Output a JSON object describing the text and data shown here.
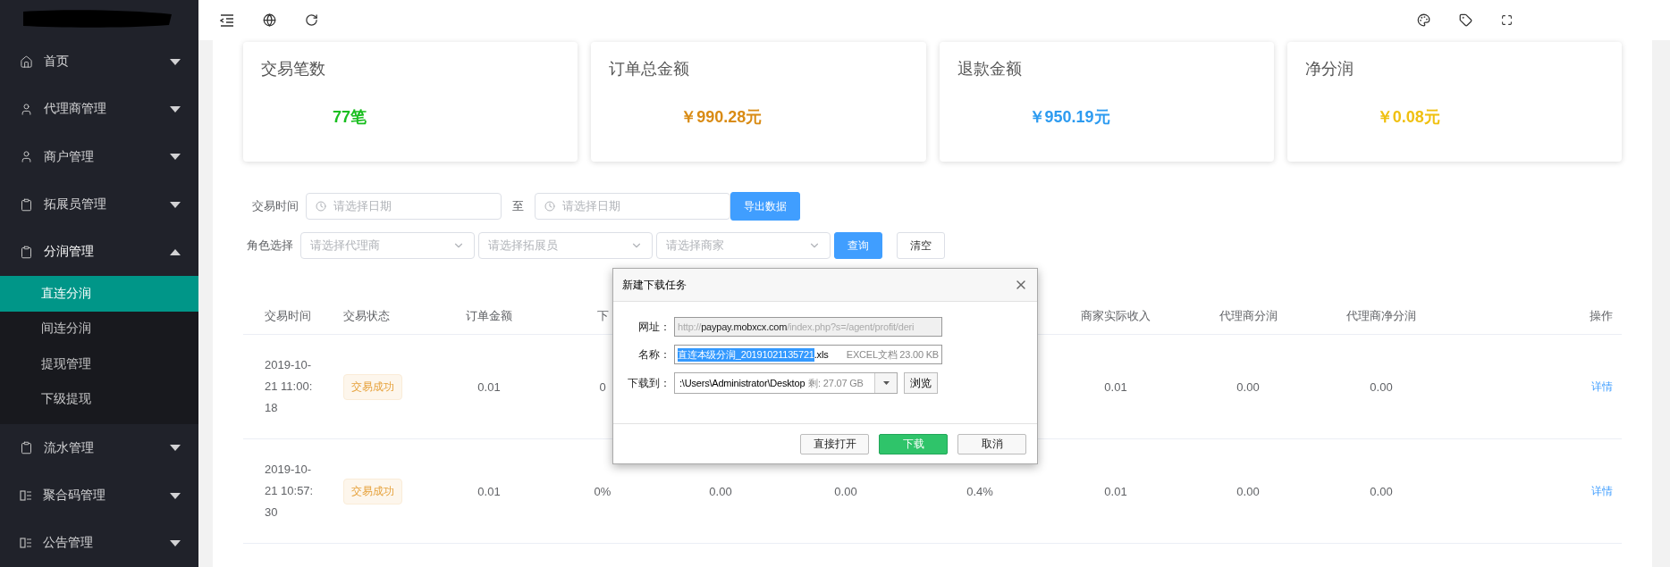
{
  "sidebar": {
    "items": [
      {
        "label": "首页",
        "expanded": false
      },
      {
        "label": "代理商管理",
        "expanded": false
      },
      {
        "label": "商户管理",
        "expanded": false
      },
      {
        "label": "拓展员管理",
        "expanded": false
      },
      {
        "label": "分润管理",
        "expanded": true,
        "children": [
          {
            "label": "直连分润",
            "selected": true
          },
          {
            "label": "间连分润",
            "selected": false
          },
          {
            "label": "提现管理",
            "selected": false
          },
          {
            "label": "下级提现",
            "selected": false
          }
        ]
      },
      {
        "label": "流水管理",
        "expanded": false
      },
      {
        "label": "聚合码管理",
        "expanded": false
      },
      {
        "label": "公告管理",
        "expanded": false
      }
    ]
  },
  "stats": [
    {
      "title": "交易笔数",
      "value": "77笔",
      "color": "#19be1f"
    },
    {
      "title": "订单总金额",
      "value": "￥990.28元",
      "color": "#d98b14"
    },
    {
      "title": "退款金额",
      "value": "￥950.19元",
      "color": "#2d9bf0"
    },
    {
      "title": "净分润",
      "value": "￥0.08元",
      "color": "#f0c010"
    }
  ],
  "filters": {
    "date_label": "交易时间",
    "date_from": {
      "placeholder": "请选择日期"
    },
    "date_sep": "至",
    "date_to": {
      "placeholder": "请选择日期"
    },
    "export_button": "导出数据",
    "role_label": "角色选择",
    "selects": [
      {
        "placeholder": "请选择代理商"
      },
      {
        "placeholder": "请选择拓展员"
      },
      {
        "placeholder": "请选择商家"
      }
    ],
    "query_button": "查询",
    "clear_button": "清空"
  },
  "table": {
    "columns": {
      "time": "交易时间",
      "status": "交易状态",
      "amount": "订单金额",
      "column_4": "下",
      "merchant_income": "商家实际收入",
      "agent_profit": "代理商分润",
      "agent_net_profit": "代理商净分润",
      "action": "操作"
    },
    "rows": [
      {
        "time": "2019-10-21 11:00:18",
        "status": "交易成功",
        "amount": "0.01",
        "column_4": "0",
        "merchant_income": "0.01",
        "agent_profit": "0.00",
        "agent_net_profit": "0.00",
        "action": "详情"
      },
      {
        "time": "2019-10-21 10:57:30",
        "status": "交易成功",
        "amount": "0.01",
        "column_4": "0%",
        "column_5": "0.00",
        "column_6": "0.00",
        "column_7": "0.4%",
        "merchant_income": "0.01",
        "agent_profit": "0.00",
        "agent_net_profit": "0.00",
        "action": "详情"
      }
    ]
  },
  "dialog": {
    "title": "新建下载任务",
    "url_label": "网址：",
    "url": {
      "scheme": "http://",
      "host": "paypay.mobxcx.com",
      "path": "/index.php?s=/agent/profit/deri"
    },
    "name_label": "名称：",
    "name_selected": "直连本级分润_20191021135721",
    "name_rest": ".xls",
    "file_info": "EXCEL文档 23.00 KB",
    "path_label": "下载到：",
    "path": ":\\Users\\Administrator\\Desktop",
    "free_space": "剩: 27.07 GB",
    "browse_button": "浏览",
    "buttons": [
      {
        "label": "直接打开",
        "kind": "plain"
      },
      {
        "label": "下载",
        "kind": "primary"
      },
      {
        "label": "取消",
        "kind": "plain"
      }
    ]
  }
}
